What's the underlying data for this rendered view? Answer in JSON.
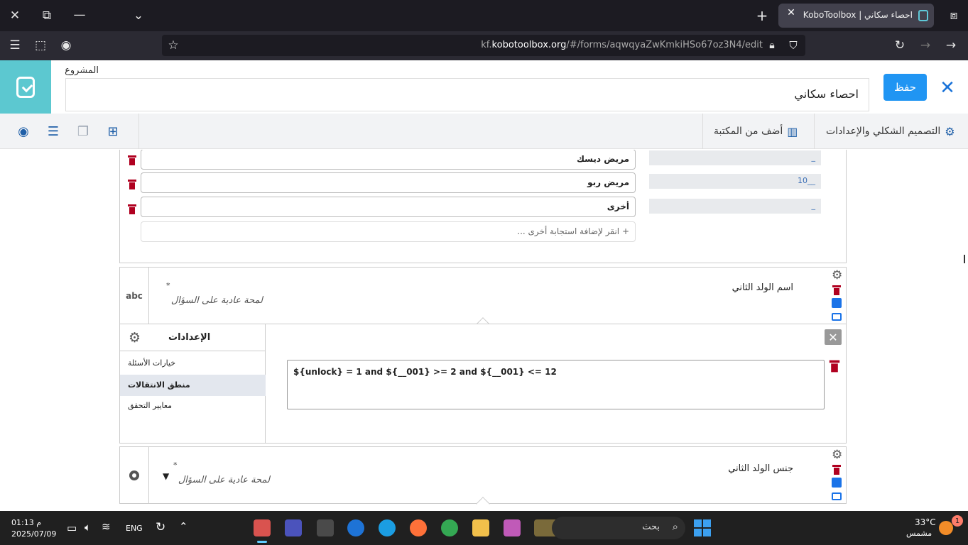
{
  "browser": {
    "tab_title": "احصاء سكاني | KoboToolbox",
    "url_prefix": "kf.",
    "url_domain": "kobotoolbox.org",
    "url_path": "/#/forms/aqwqyaZwKmkiHSo67oz3N4/edit"
  },
  "header": {
    "project_label": "المشروع",
    "project_name": "احصاء سكاني",
    "save_label": "حفظ"
  },
  "toolbar": {
    "design_settings": "التصميم الشكلي والإعدادات",
    "add_from_library": "أضف من المكتبة"
  },
  "choices": [
    {
      "label": "مريض ديسك",
      "value": "_"
    },
    {
      "label": "مريض ربو",
      "value": "10__"
    },
    {
      "label": "أخرى",
      "value": "_"
    }
  ],
  "add_choice": "+ انقر لإضافة استجابة أخرى ...",
  "question1": {
    "type": "abc",
    "label": "اسم الولد الثاني",
    "hint": "لمحة عادية على السؤال",
    "required_mark": "*"
  },
  "settings": {
    "title": "الإعدادات",
    "items": [
      "خيارات الأسئلة",
      "منطق الانتقالات",
      "معايير التحقق"
    ],
    "logic_expression": "${unlock} = 1 and ${__001} >= 2 and ${__001} <= 12"
  },
  "question2": {
    "label": "جنس الولد الثاني",
    "hint": "لمحة عادية على السؤال",
    "required_mark": "*"
  },
  "taskbar": {
    "temperature": "33°C",
    "weather": "مشمس",
    "search_placeholder": "بحث",
    "language": "ENG",
    "time": "01:13 م",
    "date": "2025/07/09",
    "notification_count": "1"
  }
}
